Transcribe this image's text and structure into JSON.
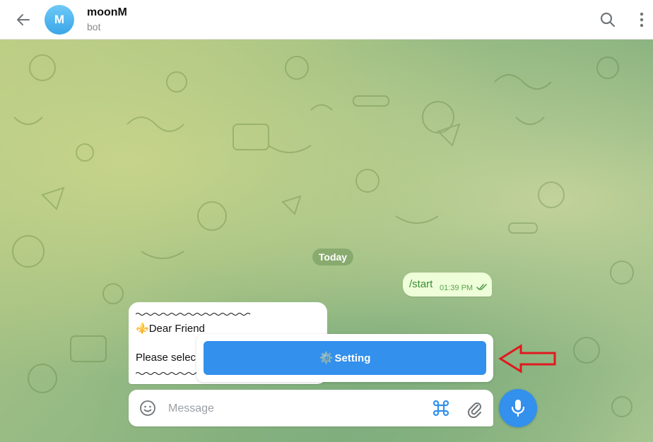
{
  "header": {
    "avatar_letter": "M",
    "title": "moonM",
    "subtitle": "bot",
    "icons": [
      "back-arrow-icon",
      "search-icon",
      "more-vertical-icon"
    ]
  },
  "chat": {
    "date_label": "Today",
    "outgoing": {
      "text": "/start",
      "time": "01:39 PM",
      "status": "read"
    },
    "incoming": {
      "line1_emoji": "⚜️",
      "line1": "Dear Friend",
      "line2": "Please selec"
    },
    "keyboard": {
      "button_icon": "⚙️",
      "button_label": "Setting"
    }
  },
  "composer": {
    "placeholder": "Message",
    "icons": [
      "emoji-icon",
      "command-icon",
      "paperclip-icon",
      "microphone-icon"
    ]
  },
  "colors": {
    "accent": "#3390ec",
    "outgoing_bubble": "#eefed9",
    "annotation_arrow": "#e0191f"
  }
}
